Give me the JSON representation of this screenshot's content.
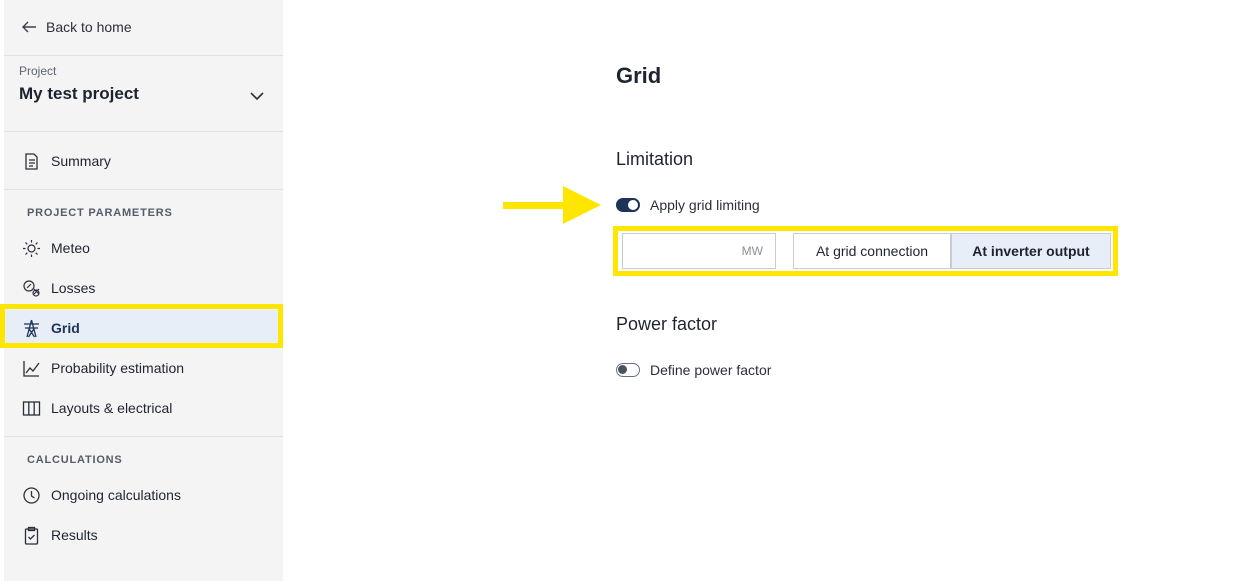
{
  "sidebar": {
    "back_label": "Back to home",
    "project_label": "Project",
    "project_name": "My test project",
    "summary_label": "Summary",
    "section_params": "PROJECT PARAMETERS",
    "items": [
      {
        "label": "Meteo",
        "icon": "sun-icon"
      },
      {
        "label": "Losses",
        "icon": "losses-icon"
      },
      {
        "label": "Grid",
        "icon": "pylon-icon",
        "active": true
      },
      {
        "label": "Probability estimation",
        "icon": "chart-line-icon"
      },
      {
        "label": "Layouts & electrical",
        "icon": "columns-icon"
      }
    ],
    "section_calc": "CALCULATIONS",
    "calc_items": [
      {
        "label": "Ongoing calculations",
        "icon": "clock-icon"
      },
      {
        "label": "Results",
        "icon": "clipboard-icon"
      }
    ]
  },
  "main": {
    "title": "Grid",
    "limitation": {
      "title": "Limitation",
      "toggle_label": "Apply grid limiting",
      "toggle_on": true,
      "unit": "MW",
      "value": "",
      "options": [
        "At grid connection",
        "At inverter output"
      ],
      "selected": "At inverter output"
    },
    "power_factor": {
      "title": "Power factor",
      "toggle_label": "Define power factor",
      "toggle_on": false
    }
  },
  "colors": {
    "highlight": "#ffe600",
    "accent": "#1e3358",
    "active_bg": "#e8eef7",
    "sidebar_bg": "#f4f4f4"
  }
}
